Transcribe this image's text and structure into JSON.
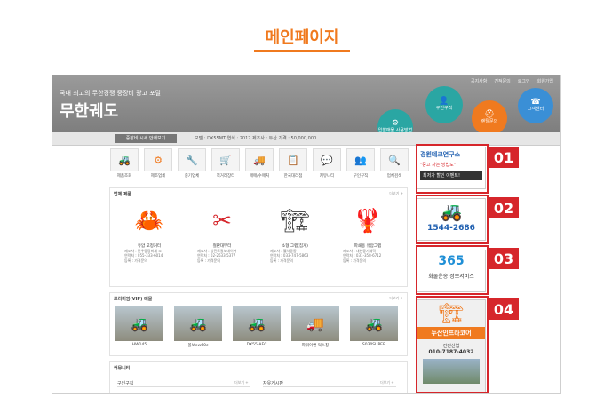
{
  "page": {
    "title": "메인페이지"
  },
  "hero": {
    "tagline": "국내 최고의 무한경쟁 중장비 광고 포탈",
    "logo": "무한궤도",
    "top_links": [
      "공지사항",
      "견적문의",
      "로그인",
      "회원가입"
    ],
    "gears": [
      {
        "label": "입찰매물 사용방법",
        "color": "#2aa6a3",
        "icon": "gear-icon"
      },
      {
        "label": "구인구직",
        "color": "#2aa6a3",
        "icon": "user-icon"
      },
      {
        "label": "렌탈문의",
        "color": "#f07a1f",
        "icon": "helmet-icon"
      },
      {
        "label": "고객센터",
        "color": "#3a8fd6",
        "icon": "phone-icon"
      }
    ]
  },
  "subbar": {
    "button": "중장비 시세 안내보기",
    "spec": "모델 : DX55MT   연식 : 2017   제조사 : 두산   가격 : 50,000,000"
  },
  "categories": [
    {
      "label": "제품조회",
      "icon": "excavator-icon"
    },
    {
      "label": "제조업체",
      "icon": "gear-icon"
    },
    {
      "label": "중기업체",
      "icon": "tools-icon"
    },
    {
      "label": "직거래장터",
      "icon": "cart-icon"
    },
    {
      "label": "매매/수매처",
      "icon": "truck-icon"
    },
    {
      "label": "한국대리점",
      "icon": "board-icon"
    },
    {
      "label": "커뮤니티",
      "icon": "community-icon"
    },
    {
      "label": "구인구직",
      "icon": "people-icon"
    },
    {
      "label": "업체검색",
      "icon": "search-icon"
    }
  ],
  "featured": {
    "title": "업체 제품",
    "more": "더보기 +",
    "items": [
      {
        "name": "유압 고정커터",
        "meta": [
          "제조사 : 진우중장비제 조",
          "연락처 : 055-333-6014",
          "등록 : 가격문의"
        ],
        "color": "#3f8fd6"
      },
      {
        "name": "철판대부터",
        "meta": [
          "제조사 : 성진로얄보데이커",
          "연락처 : 02-2633-5377",
          "등록 : 가격문의"
        ],
        "color": "#d6262b"
      },
      {
        "name": "소형 그랩(집게)",
        "meta": [
          "제조사 : 웰차동종",
          "연락처 : 033-747-5863",
          "등록 : 가격문의"
        ],
        "color": "#3c3c3c"
      },
      {
        "name": "파쇄용 유압그랩",
        "meta": [
          "제조사 : 대한중기제작",
          "연락처 : 031-358-6712",
          "등록 : 가격문의"
        ],
        "color": "#f07a1f"
      }
    ]
  },
  "vip": {
    "title": "프리미엄(VIP) 매물",
    "more": "더보기 +",
    "items": [
      "HW145",
      "볼보ew60c",
      "DX55-AEC",
      "파워이앤 익스칭",
      "S030SUPER"
    ]
  },
  "community": {
    "title": "커뮤니티",
    "col1": "구인구직",
    "col2": "자유게시판",
    "more": "더보기 +"
  },
  "ads": [
    {
      "num": "01",
      "name": "경원테크연구소",
      "line": "\"중고 사는 방법도\"",
      "sub": "최저가 할인 이벤트!"
    },
    {
      "num": "02",
      "phone": "1544-2686"
    },
    {
      "num": "03",
      "brand": "365",
      "sub": "화물운송 정보서비스"
    },
    {
      "num": "04",
      "title": "두산인프라코어",
      "phone": "010-7187-4032",
      "company": "건진산업"
    }
  ]
}
